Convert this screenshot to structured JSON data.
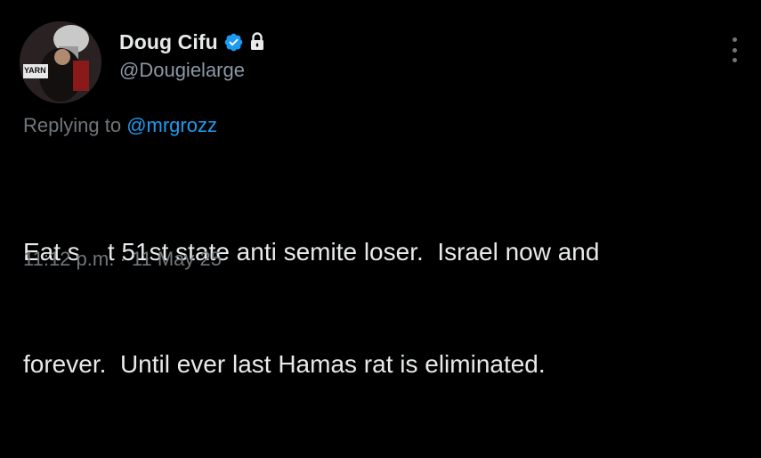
{
  "user": {
    "display_name": "Doug Cifu",
    "handle": "@Dougielarge",
    "avatar_label": "YARN"
  },
  "reply": {
    "prefix": "Replying to ",
    "mention": "@mrgrozz"
  },
  "tweet": {
    "line1": "Eat s    t 51st state anti semite loser.  Israel now and",
    "line2": "forever.  Until ever last Hamas rat is eliminated."
  },
  "timestamp": "11:12 p.m. · 11 May 25",
  "icons": {
    "verified": "verified-badge-icon",
    "lock": "lock-icon",
    "more": "more-options-icon"
  },
  "colors": {
    "background": "#000000",
    "text_primary": "#e7e9ea",
    "text_secondary": "#71767b",
    "accent": "#1d9bf0"
  }
}
